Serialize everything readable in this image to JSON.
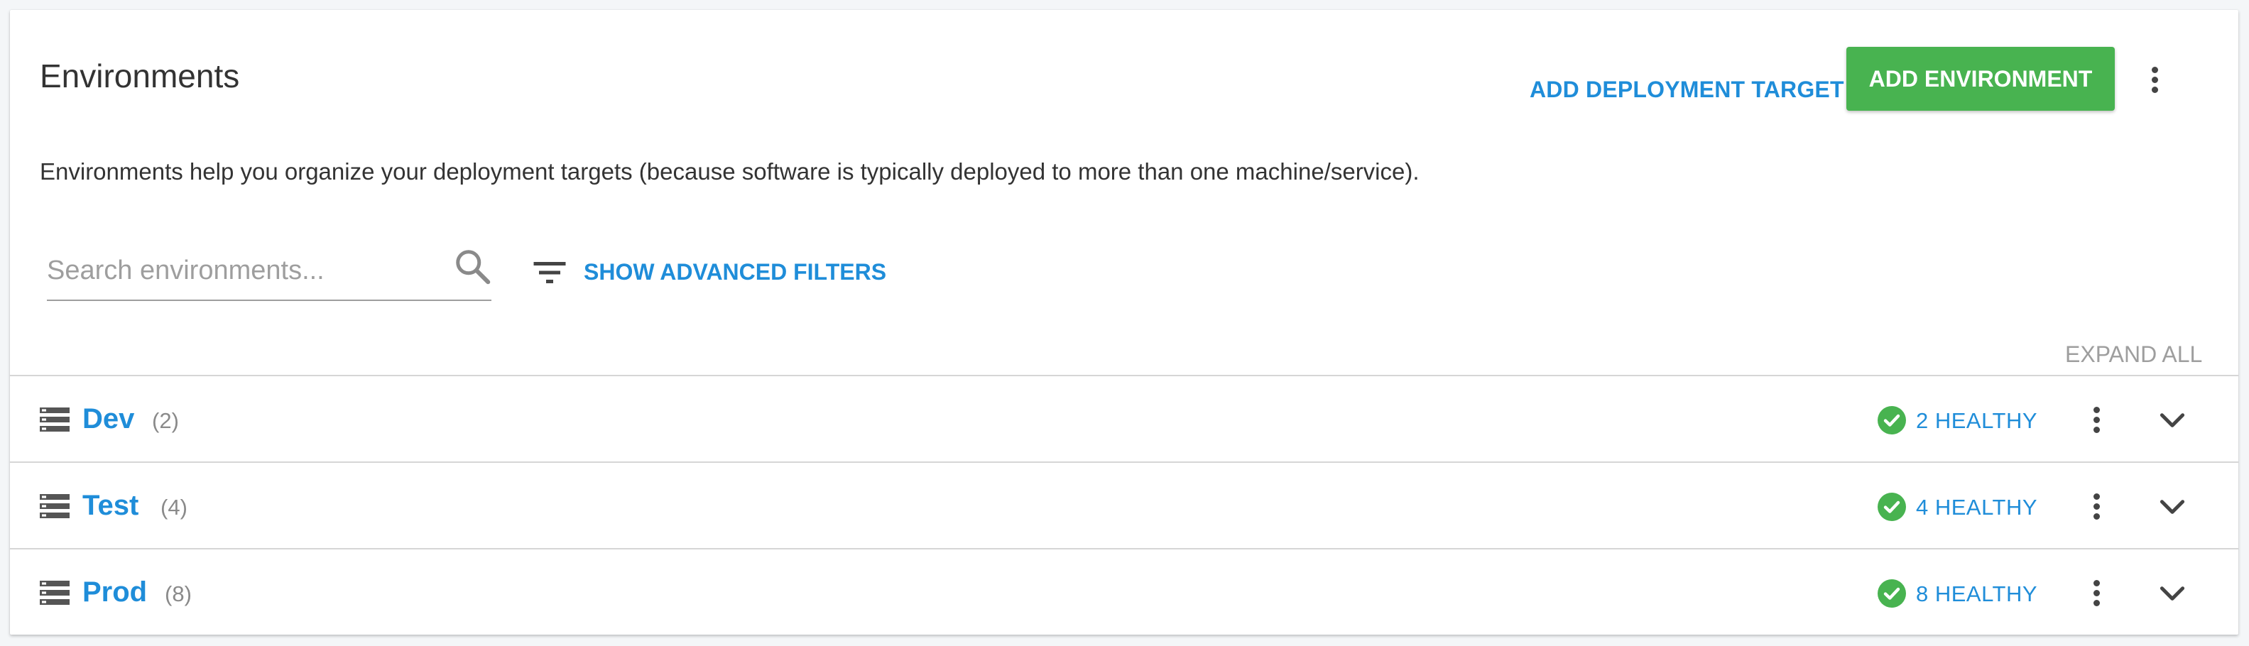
{
  "header": {
    "title": "Environments",
    "add_target_label": "ADD DEPLOYMENT TARGET",
    "add_environment_label": "ADD ENVIRONMENT"
  },
  "description": "Environments help you organize your deployment targets (because software is typically deployed to more than one machine/service).",
  "search": {
    "placeholder": "Search environments...",
    "value": ""
  },
  "filters": {
    "label": "SHOW ADVANCED FILTERS"
  },
  "expand_all_label": "EXPAND ALL",
  "environments": [
    {
      "name": "Dev",
      "count": "(2)",
      "health": "2 HEALTHY"
    },
    {
      "name": "Test",
      "count": "(4)",
      "health": "4 HEALTHY"
    },
    {
      "name": "Prod",
      "count": "(8)",
      "health": "8 HEALTHY"
    }
  ],
  "colors": {
    "accent": "#1f8dd9",
    "primary_button": "#48b350",
    "healthy": "#48b350",
    "muted_text": "#9e9e9e"
  },
  "icons": {
    "search": "search-icon",
    "filter": "filter-icon",
    "environment": "server-stack-icon",
    "healthy": "check-circle-icon",
    "menu": "more-vertical-icon",
    "expand": "chevron-down-icon"
  }
}
